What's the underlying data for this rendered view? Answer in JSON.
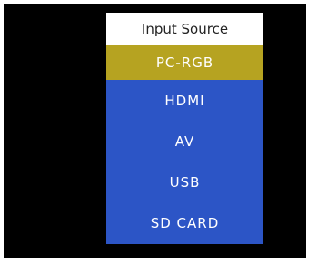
{
  "menu": {
    "title": "Input Source",
    "selected_index": 0,
    "items": [
      {
        "label": "PC-RGB"
      },
      {
        "label": "HDMI"
      },
      {
        "label": "AV"
      },
      {
        "label": "USB"
      },
      {
        "label": "SD CARD"
      }
    ]
  },
  "colors": {
    "title_bg": "#ffffff",
    "menu_bg": "#2c55c6",
    "selected_bg": "#b6a321",
    "screen_bg": "#000000"
  }
}
